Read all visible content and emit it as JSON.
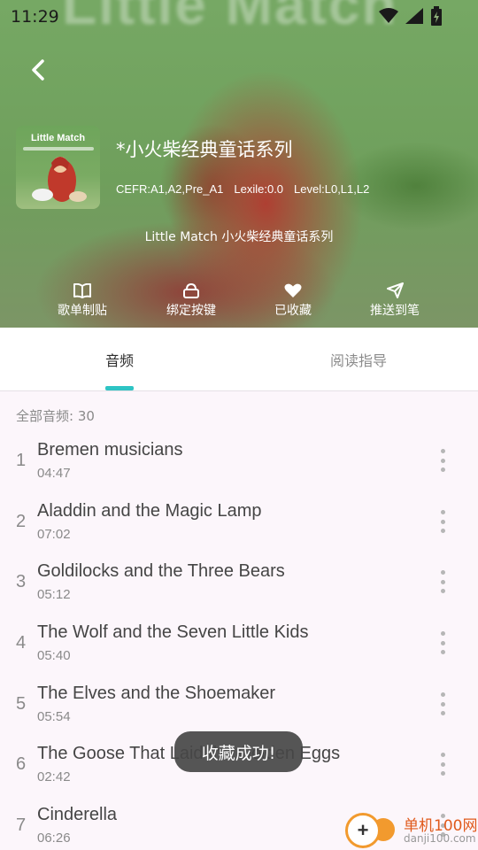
{
  "status_bar": {
    "time": "11:29",
    "icons": [
      "wifi-icon",
      "signal-icon",
      "battery-charging-icon"
    ]
  },
  "header": {
    "background_text": "Little Match",
    "cover_title": "Little Match",
    "album_title": "*小火柴经典童话系列",
    "levels": {
      "cefr": "CEFR:A1,A2,Pre_A1",
      "lexile": "Lexile:0.0",
      "level": "Level:L0,L1,L2"
    },
    "subtitle": "Little Match 小火柴经典童话系列",
    "actions": [
      {
        "label": "歌单制贴",
        "icon": "book-open-icon"
      },
      {
        "label": "绑定按键",
        "icon": "button-icon"
      },
      {
        "label": "已收藏",
        "icon": "heart-icon"
      },
      {
        "label": "推送到笔",
        "icon": "send-icon"
      }
    ]
  },
  "tabs": [
    {
      "label": "音频",
      "active": true
    },
    {
      "label": "阅读指导",
      "active": false
    }
  ],
  "list": {
    "count_label": "全部音频: 30",
    "items": [
      {
        "num": "1",
        "title": "Bremen musicians",
        "duration": "04:47"
      },
      {
        "num": "2",
        "title": "Aladdin and the Magic Lamp",
        "duration": "07:02"
      },
      {
        "num": "3",
        "title": "Goldilocks and the Three Bears",
        "duration": "05:12"
      },
      {
        "num": "4",
        "title": "The Wolf and the Seven Little Kids",
        "duration": "05:40"
      },
      {
        "num": "5",
        "title": "The Elves and the Shoemaker",
        "duration": "05:54"
      },
      {
        "num": "6",
        "title": "The Goose That Laid the Golden Eggs",
        "duration": "02:42"
      },
      {
        "num": "7",
        "title": "Cinderella",
        "duration": "06:26"
      }
    ]
  },
  "toast": "收藏成功!",
  "watermark": {
    "text": "单机100网",
    "url": "danji100.com"
  },
  "colors": {
    "accent": "#2ec4c4",
    "header_green": "#6f9f5c",
    "list_bg": "#fcf6fb"
  }
}
